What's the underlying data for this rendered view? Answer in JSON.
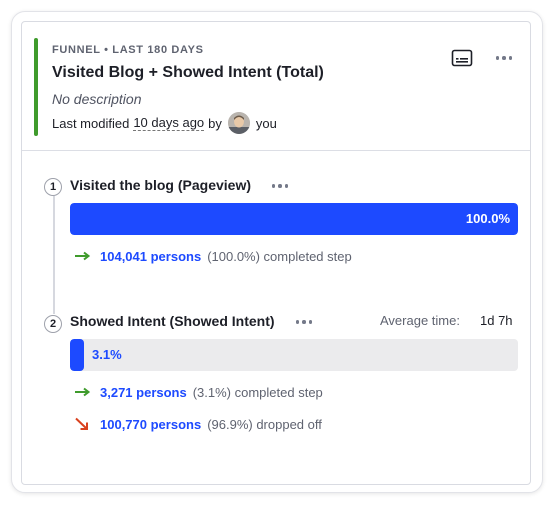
{
  "insight": {
    "kicker": "FUNNEL • LAST 180 DAYS",
    "title": "Visited Blog + Showed Intent (Total)",
    "description": "No description",
    "modified_prefix": "Last modified",
    "modified_time": "10 days ago",
    "modified_by_word": "by",
    "modified_by": "you",
    "accent_color": "#3f9b2c",
    "header_icons": [
      "subtitles-icon",
      "more-icon"
    ]
  },
  "steps": [
    {
      "number": "1",
      "title": "Visited the blog (Pageview)",
      "conversion": 1.0,
      "bar_label": "100.0%",
      "completed_count": "104,041 persons",
      "completed_pct": "(100.0%) completed step"
    },
    {
      "number": "2",
      "title": "Showed Intent (Showed Intent)",
      "avg_time_label": "Average time:",
      "avg_time_value": "1d 7h",
      "conversion": 0.031,
      "bar_label": "3.1%",
      "completed_count": "3,271 persons",
      "completed_pct": "(3.1%) completed step",
      "dropped_count": "100,770 persons",
      "dropped_pct": "(96.9%) dropped off"
    }
  ],
  "colors": {
    "bar": "#1d4aff",
    "completed_arrow": "#3f9b2c",
    "dropped_arrow": "#d9411e"
  }
}
